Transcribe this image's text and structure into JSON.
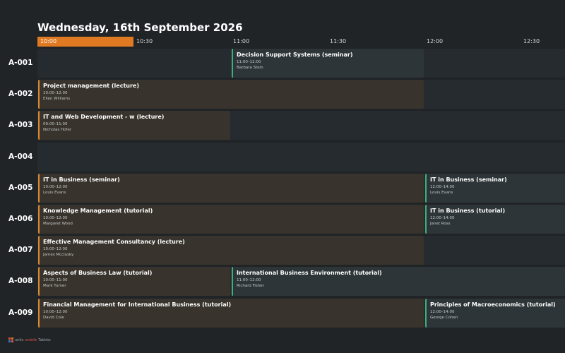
{
  "header": {
    "date_title": "Wednesday, 16th September 2026"
  },
  "timeline": {
    "current_slot": "10:00",
    "ticks": [
      "10:30",
      "11:00",
      "11:30",
      "12:00",
      "12:30"
    ]
  },
  "colors": {
    "accent": "#e07a22",
    "event_orange": "#d98a2e",
    "event_green": "#3fae7c"
  },
  "rooms": [
    {
      "name": "A-001",
      "events": [
        {
          "title": "Decision Support Systems (seminar)",
          "time": "11:00–12:00",
          "person": "Barbara Stein",
          "color": "green",
          "start": "11:00",
          "end": "12:00"
        }
      ]
    },
    {
      "name": "A-002",
      "events": [
        {
          "title": "Project management (lecture)",
          "time": "10:00–12:00",
          "person": "Ellen Williams",
          "color": "orange",
          "start": "10:00",
          "end": "12:00"
        }
      ]
    },
    {
      "name": "A-003",
      "events": [
        {
          "title": "IT and Web Development - w (lecture)",
          "time": "09:00–11:00",
          "person": "Nicholas Hofer",
          "color": "orange",
          "start": "10:00",
          "end": "11:00"
        }
      ]
    },
    {
      "name": "A-004",
      "events": []
    },
    {
      "name": "A-005",
      "events": [
        {
          "title": "IT in Business (seminar)",
          "time": "10:00–12:00",
          "person": "Louis Evans",
          "color": "orange",
          "start": "10:00",
          "end": "12:00"
        },
        {
          "title": "IT in Business (seminar)",
          "time": "12:00–14:00",
          "person": "Louis Evans",
          "color": "green",
          "start": "12:00",
          "end": "14:00"
        }
      ]
    },
    {
      "name": "A-006",
      "events": [
        {
          "title": "Knowledge Management (tutorial)",
          "time": "10:00–12:00",
          "person": "Margaret Wood",
          "color": "orange",
          "start": "10:00",
          "end": "12:00"
        },
        {
          "title": "IT in Business (tutorial)",
          "time": "12:00–14:00",
          "person": "Janet Ross",
          "color": "green",
          "start": "12:00",
          "end": "14:00"
        }
      ]
    },
    {
      "name": "A-007",
      "events": [
        {
          "title": "Effective Management Consultancy (lecture)",
          "time": "10:00–12:00",
          "person": "James Mcclusky",
          "color": "orange",
          "start": "10:00",
          "end": "12:00"
        }
      ]
    },
    {
      "name": "A-008",
      "events": [
        {
          "title": "Aspects of Business Law (tutorial)",
          "time": "10:00–11:00",
          "person": "Mark Turner",
          "color": "orange",
          "start": "10:00",
          "end": "11:00"
        },
        {
          "title": "International Business Environment (tutorial)",
          "time": "11:00–12:00",
          "person": "Richard Fisher",
          "color": "green",
          "start": "11:00",
          "end": "14:00"
        }
      ]
    },
    {
      "name": "A-009",
      "events": [
        {
          "title": "Financial Management for International Business (tutorial)",
          "time": "10:00–12:00",
          "person": "David Cole",
          "color": "orange",
          "start": "10:00",
          "end": "12:00"
        },
        {
          "title": "Principles of Macroeconomics (tutorial)",
          "time": "12:00–14:00",
          "person": "George Cohen",
          "color": "green",
          "start": "12:00",
          "end": "14:00"
        }
      ]
    }
  ],
  "branding": {
    "part1": "untis",
    "part2": "mobile",
    "part3": "Tablets"
  }
}
